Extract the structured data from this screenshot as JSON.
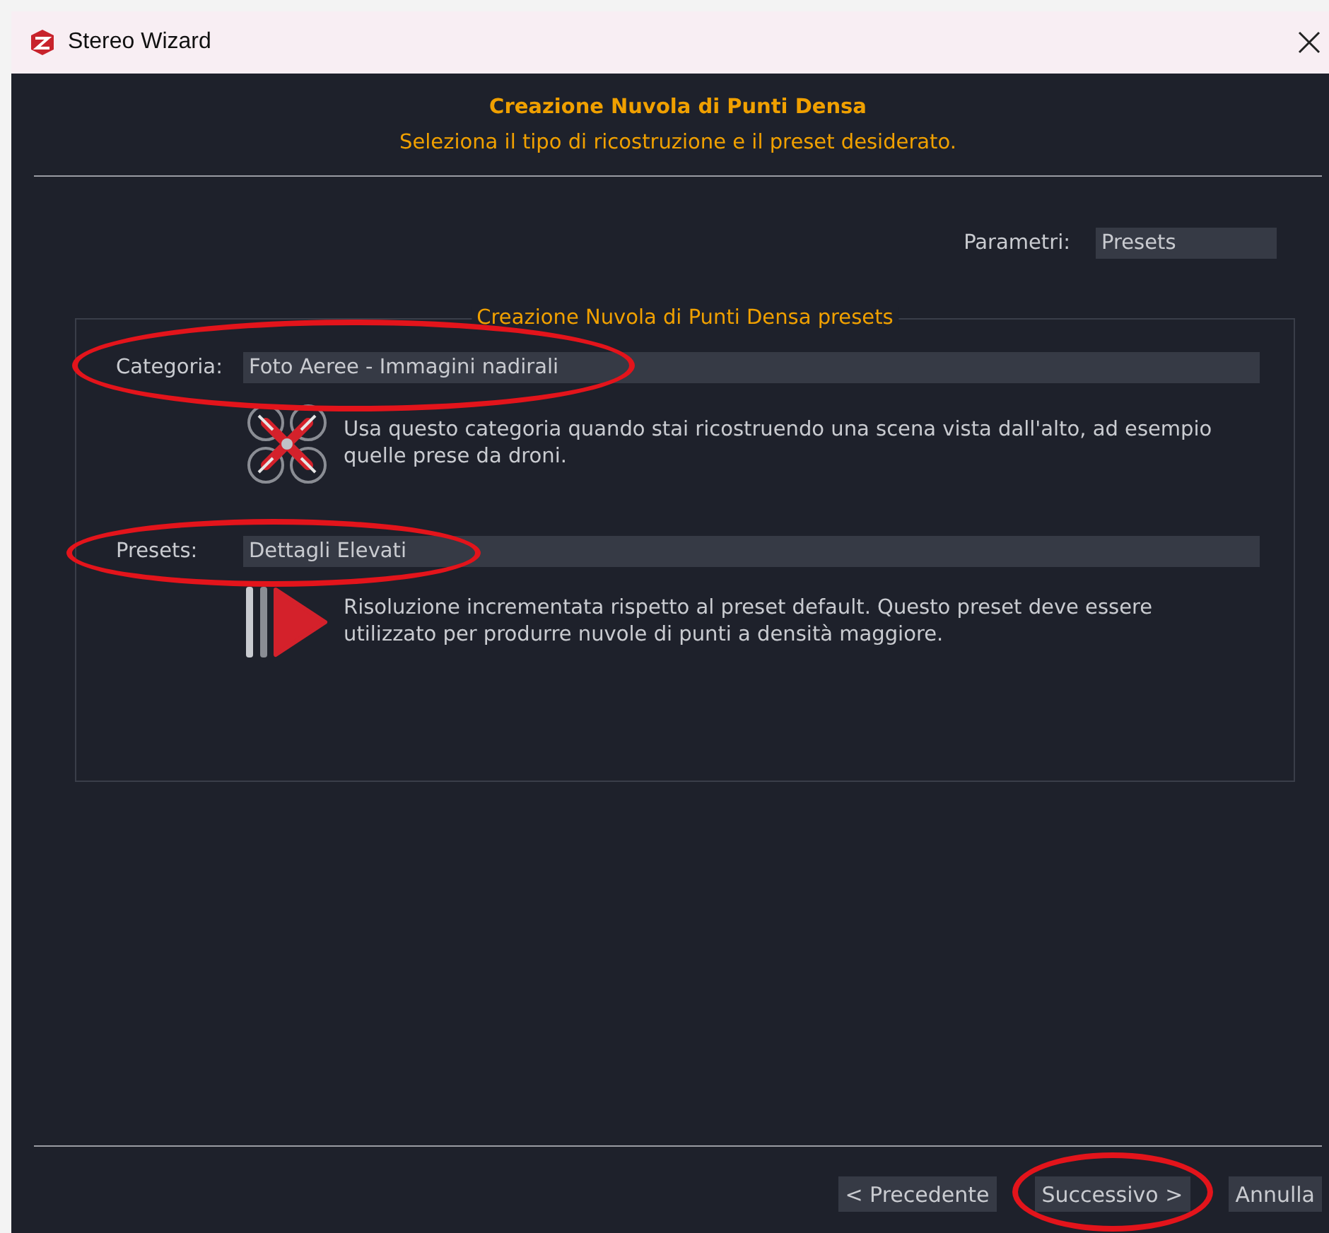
{
  "window": {
    "title": "Stereo Wizard"
  },
  "header": {
    "title": "Creazione Nuvola di Punti Densa",
    "subtitle": "Seleziona il tipo di ricostruzione e il preset desiderato."
  },
  "parameters": {
    "label": "Parametri:",
    "value": "Presets"
  },
  "group": {
    "title": "Creazione Nuvola di Punti Densa presets",
    "fields": [
      {
        "label": "Categoria:",
        "value": "Foto Aeree - Immagini nadirali",
        "circled": true,
        "kind": "drone",
        "description": "Usa questo categoria quando stai ricostruendo una scena vista dall'alto, ad esempio quelle prese da droni."
      },
      {
        "label": "Presets:",
        "value": "Dettagli Elevati",
        "circled": true,
        "kind": "detail",
        "description": "Risoluzione incrementata rispetto al preset default. Questo preset deve essere utilizzato per produrre nuvole di punti a densità maggiore."
      }
    ]
  },
  "buttons": [
    {
      "label": "< Precedente",
      "circled": false
    },
    {
      "label": "Successivo >",
      "circled": true
    },
    {
      "label": "Annulla",
      "circled": false
    }
  ]
}
